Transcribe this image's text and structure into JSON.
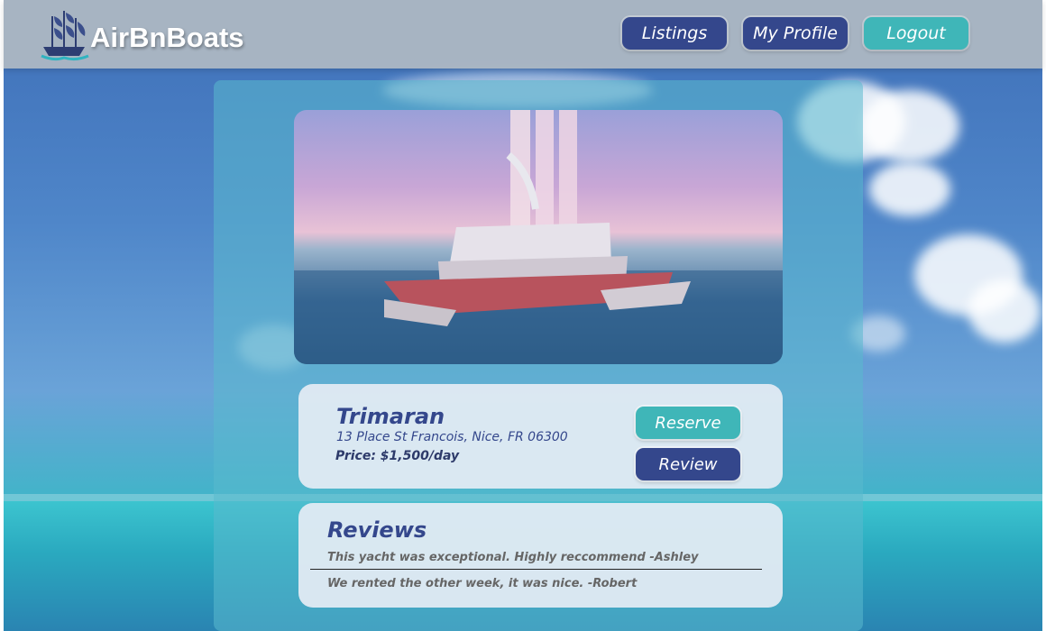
{
  "nav": {
    "brand": "AirBnBoats",
    "listings_label": "Listings",
    "profile_label": "My Profile",
    "logout_label": "Logout"
  },
  "listing": {
    "title": "Trimaran",
    "address": "13 Place St Francois, Nice, FR 06300",
    "price": "Price: $1,500/day",
    "reserve_label": "Reserve",
    "review_label": "Review"
  },
  "reviews": {
    "heading": "Reviews",
    "items": [
      "This yacht was exceptional. Highly reccommend -Ashley",
      "We rented the other week, it was nice. -Robert"
    ]
  },
  "colors": {
    "navy": "#34478c",
    "teal": "#3fb6b8"
  }
}
